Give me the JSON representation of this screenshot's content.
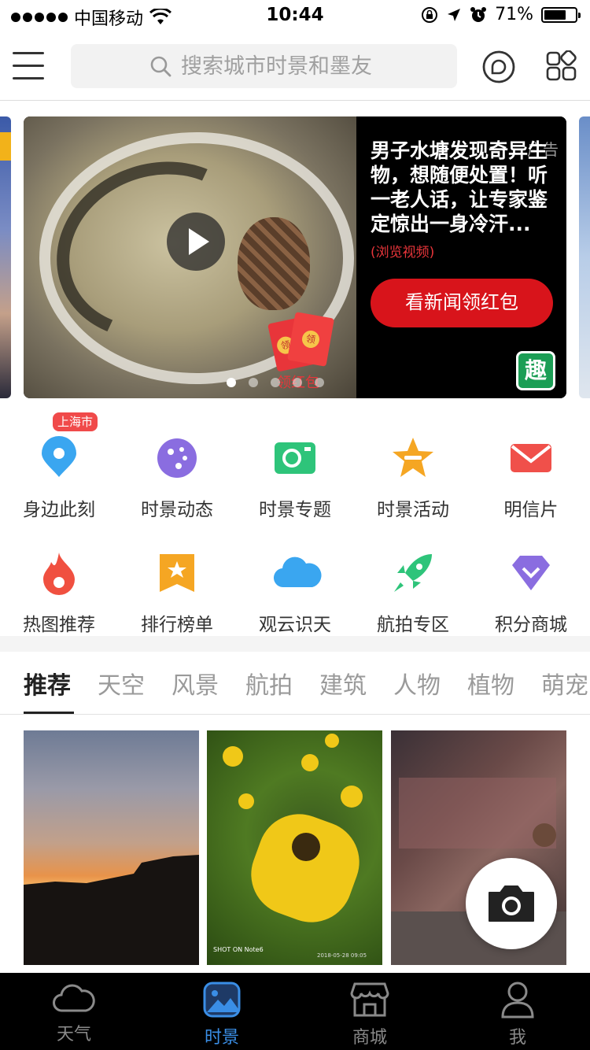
{
  "status_bar": {
    "carrier": "中国移动",
    "time": "10:44",
    "battery": "71%",
    "battery_level": 0.71
  },
  "header": {
    "search_placeholder": "搜索城市时景和墨友",
    "icons": [
      "menu-icon",
      "search-icon",
      "chat-icon",
      "grid-icon"
    ]
  },
  "banner": {
    "ad_tag": "广告",
    "headline": "男子水塘发现奇异生物，想随便处置！听一老人话，让专家鉴定惊出一身冷汗...",
    "sub": "(浏览视频)",
    "cta": "看新闻领红包",
    "red_packet_label": "领红包",
    "red_packet_coin": "领",
    "brand_badge": "趣",
    "page_count": 5,
    "active_page": 1
  },
  "quick_links": {
    "location_badge": "上海市",
    "items": [
      {
        "label": "身边此刻",
        "icon": "location-pin-icon",
        "color": "#3aa6f0"
      },
      {
        "label": "时景动态",
        "icon": "palette-icon",
        "color": "#8a6de0"
      },
      {
        "label": "时景专题",
        "icon": "camera-frame-icon",
        "color": "#2ec47a"
      },
      {
        "label": "时景活动",
        "icon": "star-badge-icon",
        "color": "#f5a623"
      },
      {
        "label": "明信片",
        "icon": "envelope-icon",
        "color": "#f0504a"
      },
      {
        "label": "热图推荐",
        "icon": "flame-icon",
        "color": "#f05040"
      },
      {
        "label": "排行榜单",
        "icon": "ranking-star-icon",
        "color": "#f5a623"
      },
      {
        "label": "观云识天",
        "icon": "cloud-icon",
        "color": "#3aa6f0"
      },
      {
        "label": "航拍专区",
        "icon": "rocket-icon",
        "color": "#2ec47a"
      },
      {
        "label": "积分商城",
        "icon": "diamond-icon",
        "color": "#8a6de0"
      }
    ]
  },
  "category_tabs": {
    "active": 0,
    "items": [
      "推荐",
      "天空",
      "风景",
      "航拍",
      "建筑",
      "人物",
      "植物",
      "萌宠"
    ]
  },
  "photos": {
    "caption_2": "SHOT ON Note6",
    "caption_2_date": "2018-05-28 09:05"
  },
  "tab_bar": {
    "active": 1,
    "items": [
      {
        "label": "天气",
        "icon": "cloud-tab-icon"
      },
      {
        "label": "时景",
        "icon": "picture-tab-icon"
      },
      {
        "label": "商城",
        "icon": "store-tab-icon"
      },
      {
        "label": "我",
        "icon": "person-tab-icon"
      }
    ]
  }
}
